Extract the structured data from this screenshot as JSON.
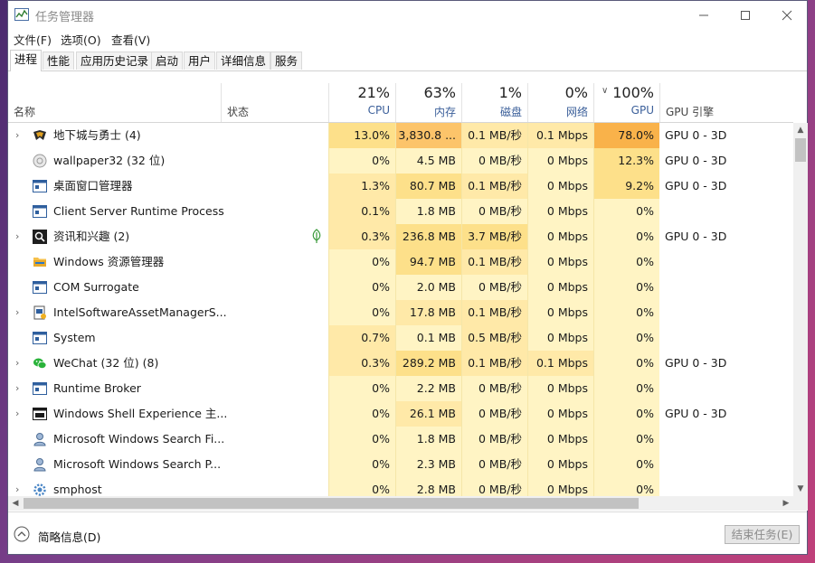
{
  "window": {
    "title": "任务管理器"
  },
  "menu": [
    "文件(F)",
    "选项(O)",
    "查看(V)"
  ],
  "tabs": [
    "进程",
    "性能",
    "应用历史记录",
    "启动",
    "用户",
    "详细信息",
    "服务"
  ],
  "active_tab": "进程",
  "columns": {
    "name": "名称",
    "status": "状态",
    "cpu": {
      "percent": "21%",
      "label": "CPU"
    },
    "memory": {
      "percent": "63%",
      "label": "内存"
    },
    "disk": {
      "percent": "1%",
      "label": "磁盘"
    },
    "network": {
      "percent": "0%",
      "label": "网络"
    },
    "gpu": {
      "percent": "100%",
      "label": "GPU"
    },
    "gpu_engine": "GPU 引擎"
  },
  "heat_colors": {
    "pale": "#fff4c4",
    "light": "#ffe9a8",
    "medium": "#fde08a",
    "strong": "#fcc46a",
    "max": "#f9b24a"
  },
  "processes": [
    {
      "name": "地下城与勇士 (4)",
      "expandable": true,
      "icon": "game-icon",
      "cpu": "13.0%",
      "memory": "3,830.8 ...",
      "disk": "0.1 MB/秒",
      "network": "0.1 Mbps",
      "gpu": "78.0%",
      "gpu_engine": "GPU 0 - 3D"
    },
    {
      "name": "wallpaper32 (32 位)",
      "expandable": false,
      "icon": "wallpaper-icon",
      "cpu": "0%",
      "memory": "4.5 MB",
      "disk": "0 MB/秒",
      "network": "0 Mbps",
      "gpu": "12.3%",
      "gpu_engine": "GPU 0 - 3D"
    },
    {
      "name": "桌面窗口管理器",
      "expandable": false,
      "icon": "window-app-icon",
      "cpu": "1.3%",
      "memory": "80.7 MB",
      "disk": "0.1 MB/秒",
      "network": "0 Mbps",
      "gpu": "9.2%",
      "gpu_engine": "GPU 0 - 3D"
    },
    {
      "name": "Client Server Runtime Process",
      "expandable": false,
      "icon": "window-app-icon",
      "cpu": "0.1%",
      "memory": "1.8 MB",
      "disk": "0 MB/秒",
      "network": "0 Mbps",
      "gpu": "0%",
      "gpu_engine": ""
    },
    {
      "name": "资讯和兴趣 (2)",
      "expandable": true,
      "icon": "search-icon",
      "cpu": "0.3%",
      "memory": "236.8 MB",
      "disk": "3.7 MB/秒",
      "network": "0 Mbps",
      "gpu": "0%",
      "gpu_engine": "GPU 0 - 3D",
      "eco": true
    },
    {
      "name": "Windows 资源管理器",
      "expandable": false,
      "icon": "folder-icon",
      "cpu": "0%",
      "memory": "94.7 MB",
      "disk": "0.1 MB/秒",
      "network": "0 Mbps",
      "gpu": "0%",
      "gpu_engine": ""
    },
    {
      "name": "COM Surrogate",
      "expandable": false,
      "icon": "window-app-icon",
      "cpu": "0%",
      "memory": "2.0 MB",
      "disk": "0 MB/秒",
      "network": "0 Mbps",
      "gpu": "0%",
      "gpu_engine": ""
    },
    {
      "name": "IntelSoftwareAssetManagerS...",
      "expandable": true,
      "icon": "intel-service-icon",
      "cpu": "0%",
      "memory": "17.8 MB",
      "disk": "0.1 MB/秒",
      "network": "0 Mbps",
      "gpu": "0%",
      "gpu_engine": ""
    },
    {
      "name": "System",
      "expandable": false,
      "icon": "window-app-icon",
      "cpu": "0.7%",
      "memory": "0.1 MB",
      "disk": "0.5 MB/秒",
      "network": "0 Mbps",
      "gpu": "0%",
      "gpu_engine": ""
    },
    {
      "name": "WeChat (32 位) (8)",
      "expandable": true,
      "icon": "wechat-icon",
      "cpu": "0.3%",
      "memory": "289.2 MB",
      "disk": "0.1 MB/秒",
      "network": "0.1 Mbps",
      "gpu": "0%",
      "gpu_engine": "GPU 0 - 3D"
    },
    {
      "name": "Runtime Broker",
      "expandable": true,
      "icon": "window-app-icon",
      "cpu": "0%",
      "memory": "2.2 MB",
      "disk": "0 MB/秒",
      "network": "0 Mbps",
      "gpu": "0%",
      "gpu_engine": ""
    },
    {
      "name": "Windows Shell Experience 主...",
      "expandable": true,
      "icon": "shell-app-icon",
      "cpu": "0%",
      "memory": "26.1 MB",
      "disk": "0 MB/秒",
      "network": "0 Mbps",
      "gpu": "0%",
      "gpu_engine": "GPU 0 - 3D"
    },
    {
      "name": "Microsoft Windows Search Fi...",
      "expandable": false,
      "icon": "search-service-icon",
      "cpu": "0%",
      "memory": "1.8 MB",
      "disk": "0 MB/秒",
      "network": "0 Mbps",
      "gpu": "0%",
      "gpu_engine": ""
    },
    {
      "name": "Microsoft Windows Search P...",
      "expandable": false,
      "icon": "search-service-icon",
      "cpu": "0%",
      "memory": "2.3 MB",
      "disk": "0 MB/秒",
      "network": "0 Mbps",
      "gpu": "0%",
      "gpu_engine": ""
    },
    {
      "name": "smphost",
      "expandable": true,
      "icon": "gear-icon",
      "cpu": "0%",
      "memory": "2.8 MB",
      "disk": "0 MB/秒",
      "network": "0 Mbps",
      "gpu": "0%",
      "gpu_engine": ""
    }
  ],
  "footer": {
    "fewer_details": "简略信息(D)",
    "end_task": "结束任务(E)"
  }
}
